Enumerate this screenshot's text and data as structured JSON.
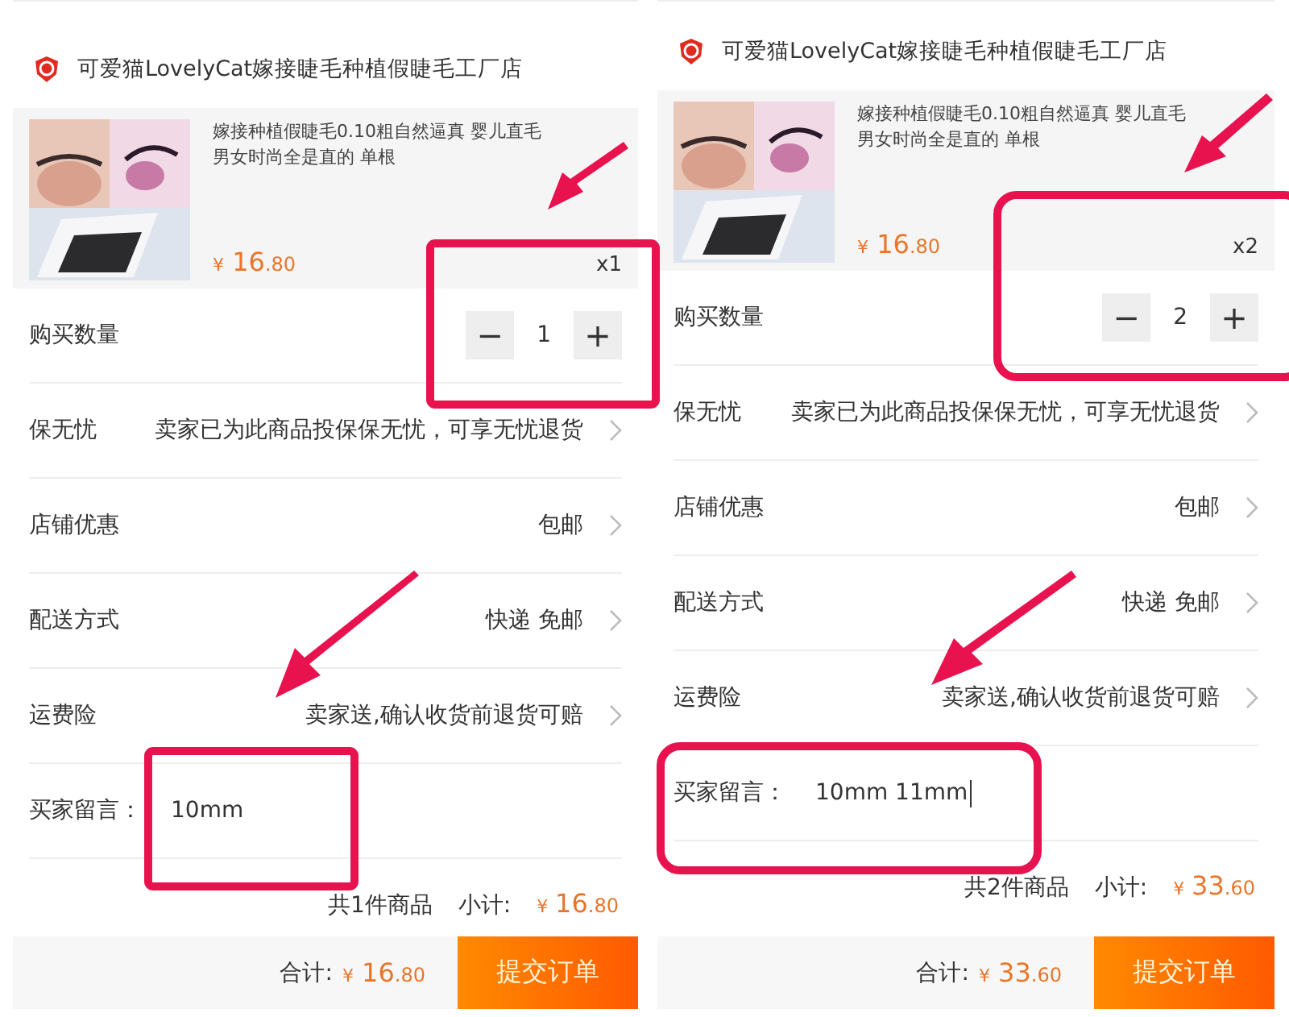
{
  "panels": [
    {
      "shop_name": "可爱猫LovelyCat嫁接睫毛种植假睫毛工厂店",
      "product": {
        "kind": "picture",
        "title": "嫁接种植假睫毛0.10粗自然逼真 婴儿直毛男女时尚全是直的 单根",
        "price_symbol": "¥",
        "price_main": "16",
        "price_cents": ".80",
        "quantity_tag": "x1"
      },
      "quantity": {
        "label": "购买数量",
        "minus": "−",
        "value": "1",
        "plus": "+"
      },
      "rows": [
        {
          "label": "保无忧",
          "value": "卖家已为此商品投保保无忧，可享无忧退货"
        },
        {
          "label": "店铺优惠",
          "value": "包邮"
        },
        {
          "label": "配送方式",
          "value": "快递 免邮"
        },
        {
          "label": "运费险",
          "value": "卖家送,确认收货前退货可赔"
        }
      ],
      "message": {
        "label": "买家留言：",
        "value": "10mm",
        "cursor": false
      },
      "summary": {
        "count": "共1件商品",
        "subtotal_label": "小计:",
        "symbol": "¥",
        "main": "16",
        "cents": ".80"
      },
      "footer": {
        "total_label": "合计:",
        "symbol": "¥",
        "main": "16",
        "cents": ".80",
        "submit": "提交订单"
      }
    },
    {
      "shop_name": "可爱猫LovelyCat嫁接睫毛种植假睫毛工厂店",
      "product": {
        "kind": "picture",
        "title": "嫁接种植假睫毛0.10粗自然逼真 婴儿直毛男女时尚全是直的 单根",
        "price_symbol": "¥",
        "price_main": "16",
        "price_cents": ".80",
        "quantity_tag": "x2"
      },
      "quantity": {
        "label": "购买数量",
        "minus": "−",
        "value": "2",
        "plus": "+"
      },
      "rows": [
        {
          "label": "保无忧",
          "value": "卖家已为此商品投保保无忧，可享无忧退货"
        },
        {
          "label": "店铺优惠",
          "value": "包邮"
        },
        {
          "label": "配送方式",
          "value": "快递 免邮"
        },
        {
          "label": "运费险",
          "value": "卖家送,确认收货前退货可赔"
        }
      ],
      "message": {
        "label": "买家留言：",
        "value": "10mm 11mm",
        "cursor": true
      },
      "summary": {
        "count": "共2件商品",
        "subtotal_label": "小计:",
        "symbol": "¥",
        "main": "33",
        "cents": ".60"
      },
      "footer": {
        "total_label": "合计:",
        "symbol": "¥",
        "main": "33",
        "cents": ".60",
        "submit": "提交订单"
      }
    }
  ]
}
